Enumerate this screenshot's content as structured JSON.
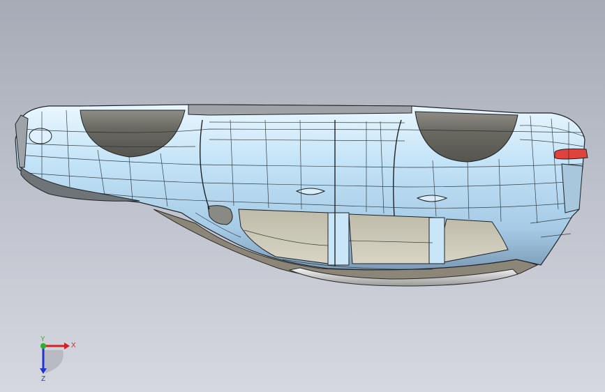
{
  "viewport": {
    "background_top": "#a7abb6",
    "background_bottom": "#d6d8e0"
  },
  "model": {
    "body_color": "#bfe0f5",
    "body_highlight": "#e8f6ff",
    "body_shadow": "#88a9c4",
    "wheel_well_color": "#5f5e58",
    "glass_color": "#cbc7b5",
    "tail_light_color": "#e0433e",
    "wire_color": "#1e2326"
  },
  "triad": {
    "x_label": "X",
    "y_label": "Y",
    "z_label": "Z",
    "x_color": "#d32020",
    "y_color": "#2db02d",
    "z_color": "#2233cc"
  }
}
